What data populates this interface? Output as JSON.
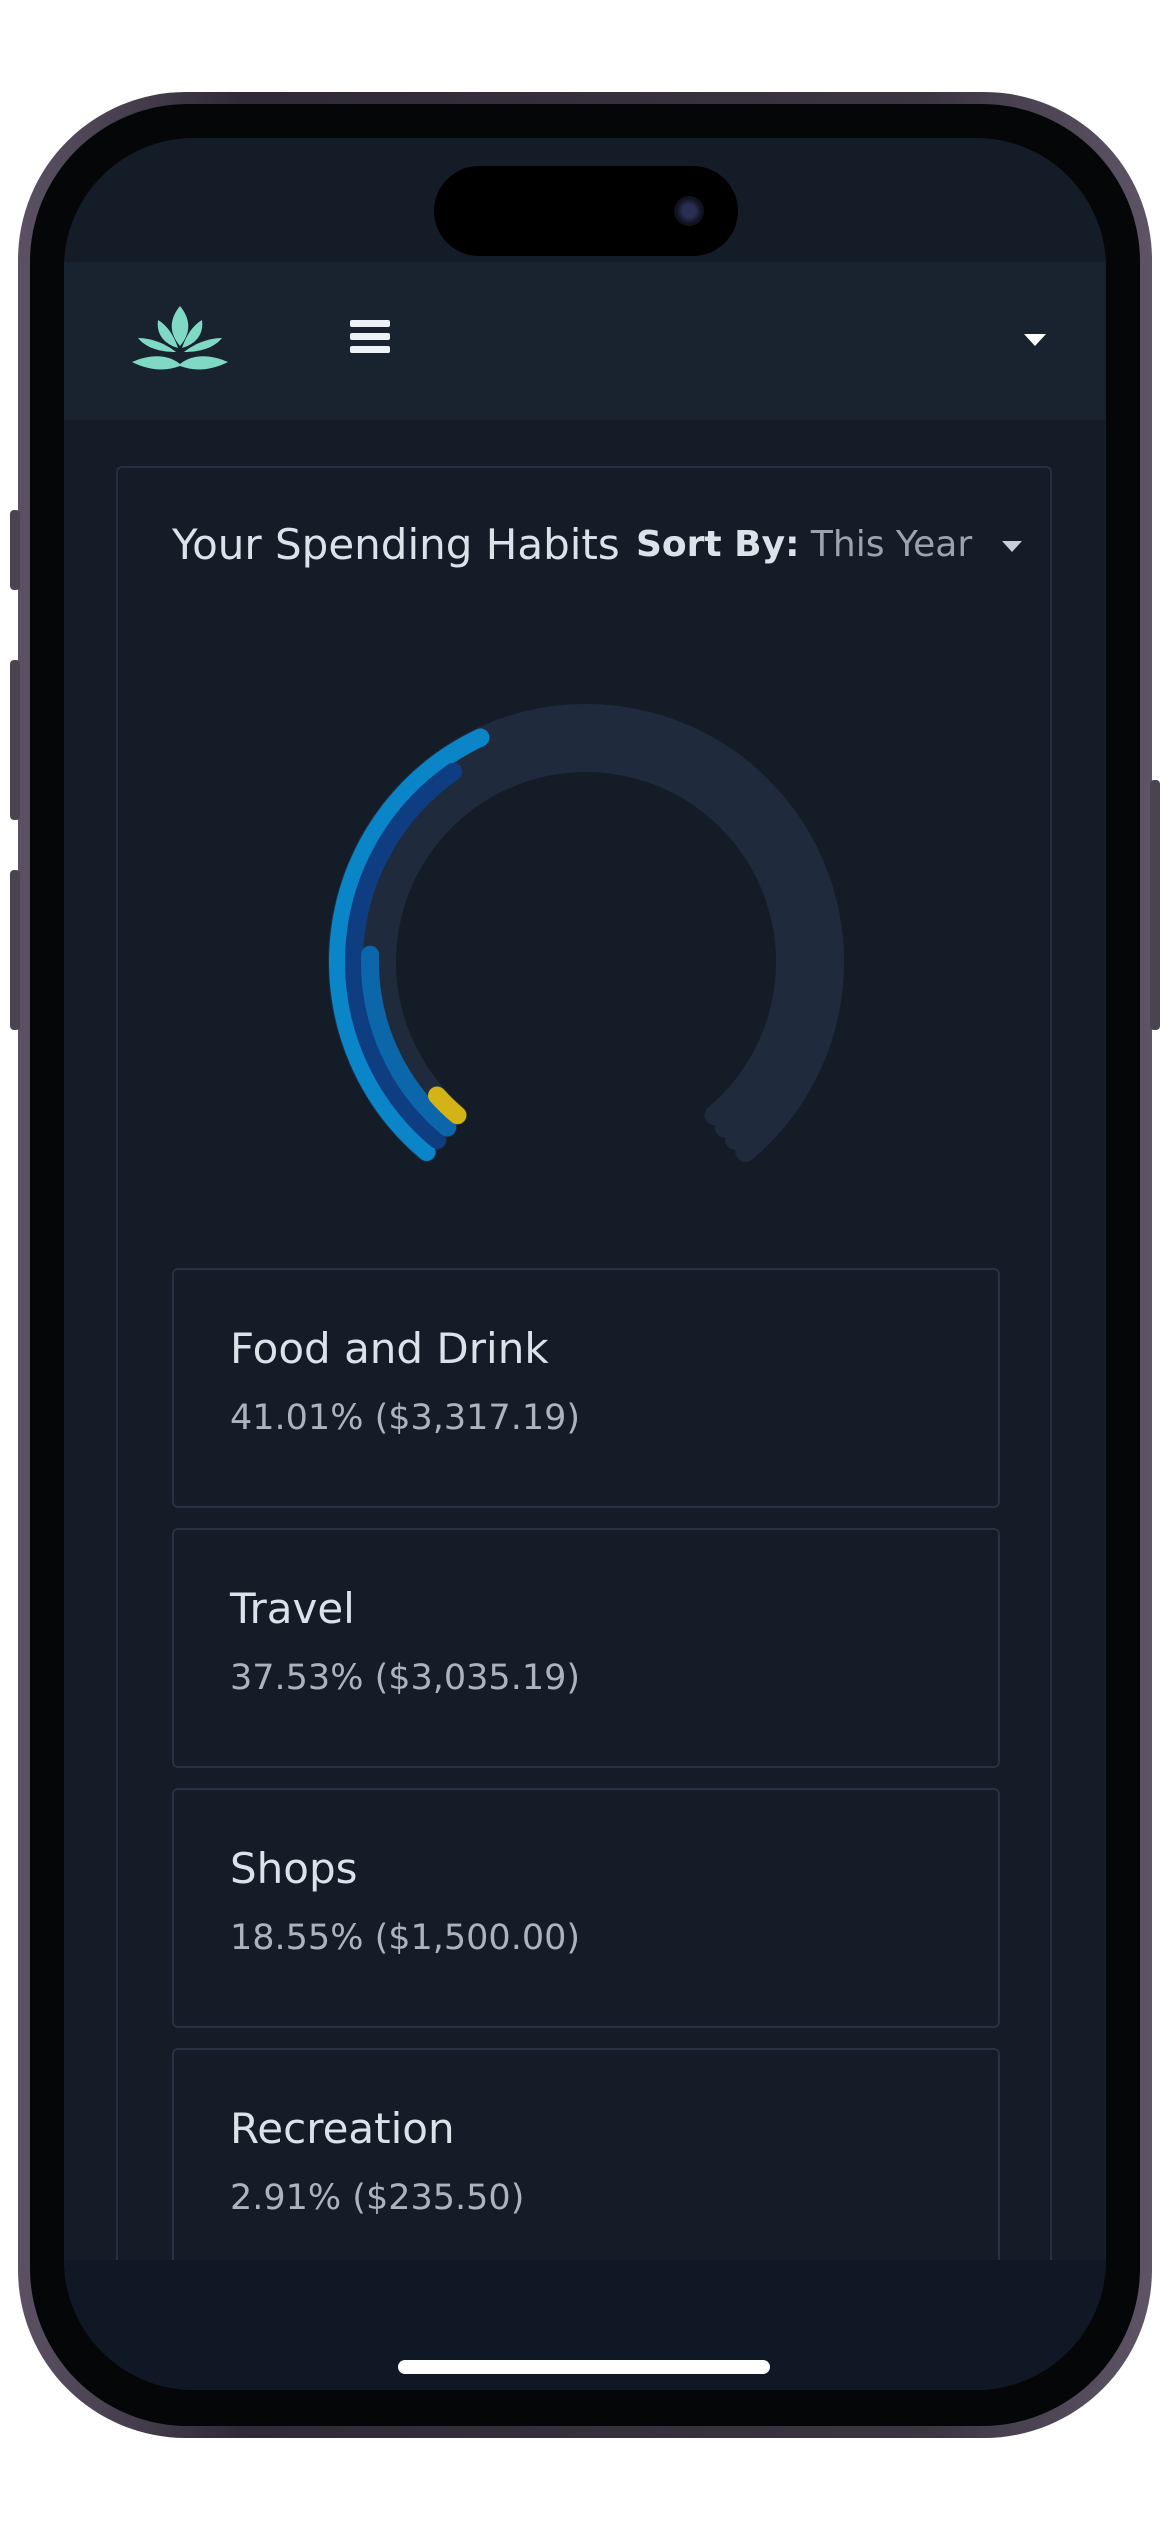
{
  "header": {
    "logo_icon": "lotus-logo-icon",
    "menu_icon": "hamburger-menu-icon",
    "dropdown_icon": "caret-down-icon"
  },
  "spending": {
    "title": "Your Spending Habits",
    "sort_label": "Sort By:",
    "sort_value": "This Year"
  },
  "chart_data": {
    "type": "radial-bar",
    "track_color": "#1f2b3d",
    "series": [
      {
        "name": "Food and Drink",
        "percent": 41.01,
        "color": "#0a86c8"
      },
      {
        "name": "Travel",
        "percent": 37.53,
        "color": "#0e3d82"
      },
      {
        "name": "Shops",
        "percent": 18.55,
        "color": "#0c66aa"
      },
      {
        "name": "Recreation",
        "percent": 2.91,
        "color": "#d4b316"
      }
    ]
  },
  "categories": [
    {
      "name": "Food and Drink",
      "value": "41.01% ($3,317.19)"
    },
    {
      "name": "Travel",
      "value": "37.53% ($3,035.19)"
    },
    {
      "name": "Shops",
      "value": "18.55% ($1,500.00)"
    },
    {
      "name": "Recreation",
      "value": "2.91% ($235.50)"
    }
  ],
  "colors": {
    "background": "#141c28",
    "navbar": "#19222f",
    "logo": "#7fd9c4"
  }
}
